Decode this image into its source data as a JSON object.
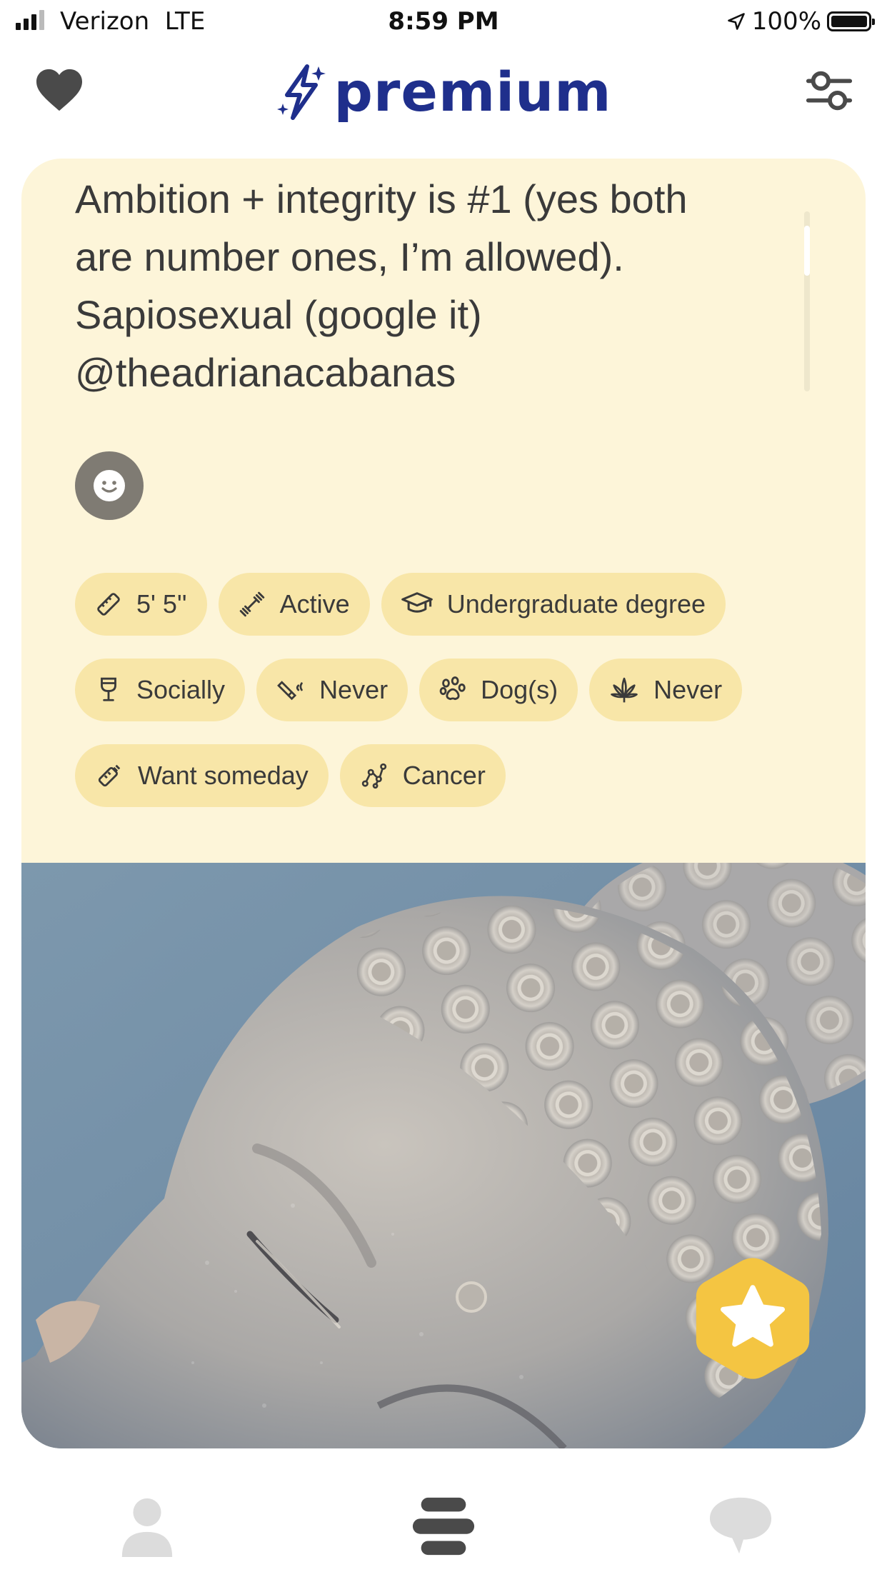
{
  "status_bar": {
    "carrier": "Verizon",
    "network": "LTE",
    "time": "8:59 PM",
    "battery": "100%",
    "icons": [
      "signal-bars-icon",
      "location-arrow-icon",
      "battery-icon"
    ]
  },
  "header": {
    "logo_text": "premium",
    "icons": [
      "heart-icon",
      "sparkle-bolt-icon",
      "filter-sliders-icon"
    ]
  },
  "profile": {
    "bio_lines": [
      "Ambition + integrity is #1 (yes both",
      "are number ones, I’m allowed).",
      "Sapiosexual (google it)",
      "@theadrianacabanas"
    ],
    "chips": [
      {
        "label": "5' 5''",
        "icon": "ruler-icon"
      },
      {
        "label": "Active",
        "icon": "dumbbell-icon"
      },
      {
        "label": "Undergraduate degree",
        "icon": "graduation-cap-icon"
      },
      {
        "label": "Socially",
        "icon": "wine-glass-icon"
      },
      {
        "label": "Never",
        "icon": "cigarette-icon"
      },
      {
        "label": "Dog(s)",
        "icon": "paw-icon"
      },
      {
        "label": "Never",
        "icon": "cannabis-leaf-icon"
      },
      {
        "label": "Want someday",
        "icon": "baby-bottle-icon"
      },
      {
        "label": "Cancer",
        "icon": "zodiac-constellation-icon"
      }
    ],
    "photo": {
      "icon": "star-badge-icon"
    }
  },
  "colors": {
    "card_bg": "#fdf5d9",
    "chip_bg": "#f8e6a8",
    "brand_blue": "#1f2f8c",
    "star_badge": "#f4c542"
  },
  "bottom_nav": {
    "items": [
      "profile-icon",
      "stack-icon",
      "chat-bubble-icon"
    ]
  }
}
